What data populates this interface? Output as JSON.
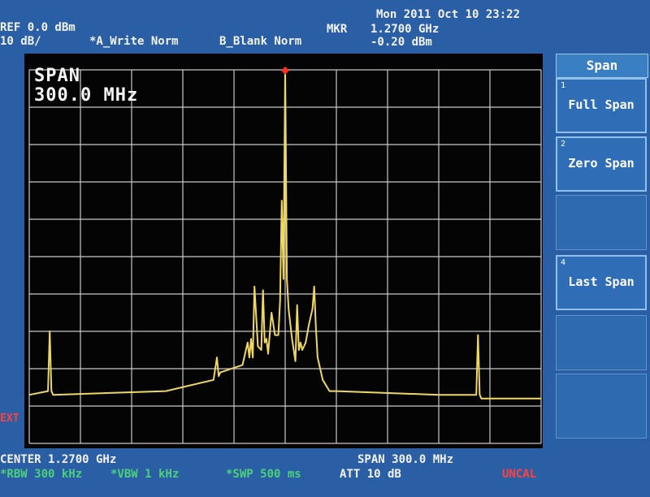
{
  "header": {
    "datetime": "Mon 2011 Oct 10 23:22",
    "ref_level": "REF 0.0 dBm",
    "scale": "10 dB/",
    "trace_a": "*A_Write Norm",
    "trace_b": "B_Blank Norm",
    "marker_label": "MKR",
    "marker_freq": "1.2700 GHz",
    "marker_level": "-0.20 dBm"
  },
  "overlay": {
    "line1": "SPAN",
    "line2": "300.0 MHz"
  },
  "left_edge_text": "EXT",
  "softkeys": {
    "title": "Span",
    "items": [
      {
        "num": "1",
        "label": "Full Span"
      },
      {
        "num": "2",
        "label": "Zero Span"
      },
      {
        "num": "4",
        "label": "Last Span"
      }
    ]
  },
  "footer": {
    "center": "CENTER 1.2700 GHz",
    "span": "SPAN 300.0 MHz",
    "rbw": "*RBW 300 kHz",
    "vbw": "*VBW 1 kHz",
    "swp": "*SWP 500 ms",
    "att": "ATT 10 dB",
    "uncal": "UNCAL"
  },
  "colors": {
    "trace": "#f0d860",
    "marker": "#ff3020",
    "grid": "#c8c8c8"
  },
  "chart_data": {
    "type": "line",
    "x_unit": "MHz",
    "y_unit": "dBm",
    "xlim": [
      1120,
      1420
    ],
    "ylim": [
      -100,
      0
    ],
    "grid_divisions": {
      "x": 10,
      "y": 10
    },
    "marker": {
      "x": 1270,
      "y": -0.2
    },
    "x": [
      1120,
      1131,
      1132,
      1133,
      1134,
      1200,
      1228,
      1230,
      1231,
      1232,
      1245,
      1248,
      1249,
      1250,
      1251,
      1252,
      1254,
      1256,
      1257,
      1258,
      1259,
      1260,
      1262,
      1264,
      1266,
      1267,
      1268,
      1269,
      1270,
      1271,
      1272,
      1274,
      1276,
      1277,
      1278,
      1279,
      1280,
      1282,
      1284,
      1286,
      1287,
      1288,
      1289,
      1290,
      1292,
      1296,
      1300,
      1360,
      1382,
      1383,
      1384,
      1385,
      1420
    ],
    "y": [
      -87,
      -86,
      -70,
      -86,
      -87,
      -86,
      -83,
      -77,
      -82,
      -81,
      -79,
      -73,
      -77,
      -72,
      -77,
      -58,
      -74,
      -75,
      -59,
      -73,
      -72,
      -76,
      -65,
      -71,
      -71,
      -62,
      -35,
      -56,
      0,
      -56,
      -64,
      -72,
      -78,
      -63,
      -75,
      -73,
      -75,
      -73,
      -68,
      -64,
      -58,
      -69,
      -77,
      -79,
      -83,
      -86,
      -86,
      -87,
      -87,
      -71,
      -87,
      -88,
      -88
    ]
  }
}
